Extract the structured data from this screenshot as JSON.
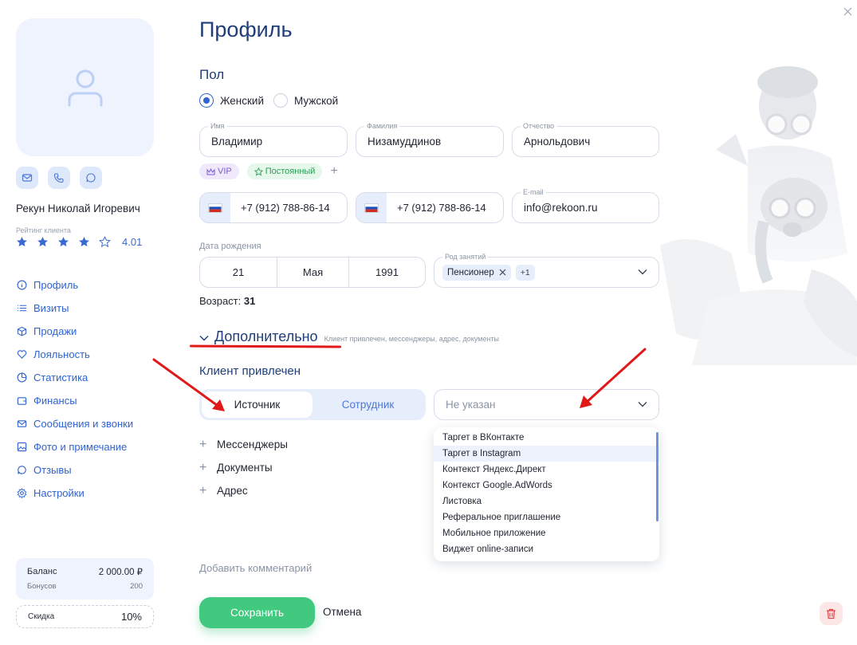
{
  "sidebar": {
    "client_name": "Рекун Николай Игоревич",
    "rating_label": "Рейтинг клиента",
    "rating_value": "4.01",
    "rating_stars": 4,
    "nav": [
      {
        "label": "Профиль",
        "icon": "info-icon"
      },
      {
        "label": "Визиты",
        "icon": "list-icon"
      },
      {
        "label": "Продажи",
        "icon": "box-icon"
      },
      {
        "label": "Лояльность",
        "icon": "heart-icon"
      },
      {
        "label": "Статистика",
        "icon": "pie-chart-icon"
      },
      {
        "label": "Финансы",
        "icon": "wallet-icon"
      },
      {
        "label": "Сообщения и звонки",
        "icon": "mail-icon"
      },
      {
        "label": "Фото и примечание",
        "icon": "image-icon"
      },
      {
        "label": "Отзывы",
        "icon": "chat-icon"
      },
      {
        "label": "Настройки",
        "icon": "gear-icon"
      }
    ],
    "balance_label": "Баланс",
    "balance_value": "2 000.00 ₽",
    "bonus_label": "Бонусов",
    "bonus_value": "200",
    "discount_label": "Скидка",
    "discount_value": "10%"
  },
  "main": {
    "title": "Профиль",
    "gender_title": "Пол",
    "gender_options": [
      "Женский",
      "Мужской"
    ],
    "gender_selected": "Женский",
    "fields": {
      "first_name_label": "Имя",
      "first_name": "Владимир",
      "last_name_label": "Фамилия",
      "last_name": "Низамуддинов",
      "patronymic_label": "Отчество",
      "patronymic": "Арнольдович"
    },
    "tags": {
      "vip": "VIP",
      "permanent": "Постоянный",
      "add": "+"
    },
    "phone1": "+7 (912) 788-86-14",
    "phone2": "+7 (912) 788-86-14",
    "email_label": "E-mail",
    "email": "info@rekoon.ru",
    "dob_label": "Дата рождения",
    "dob_day": "21",
    "dob_month": "Мая",
    "dob_year": "1991",
    "occupation_label": "Род занятий",
    "occupation_chip": "Пенсионер",
    "occupation_more": "+1",
    "age_label": "Возраст:",
    "age_value": "31",
    "extra_title": "Дополнительно",
    "extra_subtitle": "Клиент привлечен, мессенджеры, адрес, документы",
    "attracted_title": "Клиент привлечен",
    "segment": [
      "Источник",
      "Сотрудник"
    ],
    "segment_active": "Источник",
    "source_placeholder": "Не указан",
    "expanders": [
      "Мессенджеры",
      "Документы",
      "Адрес"
    ],
    "dropdown_options": [
      "Таргет в ВКонтакте",
      "Таргет в Instagram",
      "Контекст Яндекс.Директ",
      "Контекст Google.AdWords",
      "Листовка",
      "Реферальное приглашение",
      "Мобильное приложение",
      "Виджет online-записи"
    ],
    "dropdown_highlighted": "Таргет в Instagram",
    "add_comment": "Добавить комментарий",
    "save": "Сохранить",
    "cancel": "Отмена"
  },
  "colors": {
    "accent": "#2f63cf",
    "title": "#1f3e7a",
    "save_green": "#41c980",
    "annotation_red": "#e01818"
  }
}
